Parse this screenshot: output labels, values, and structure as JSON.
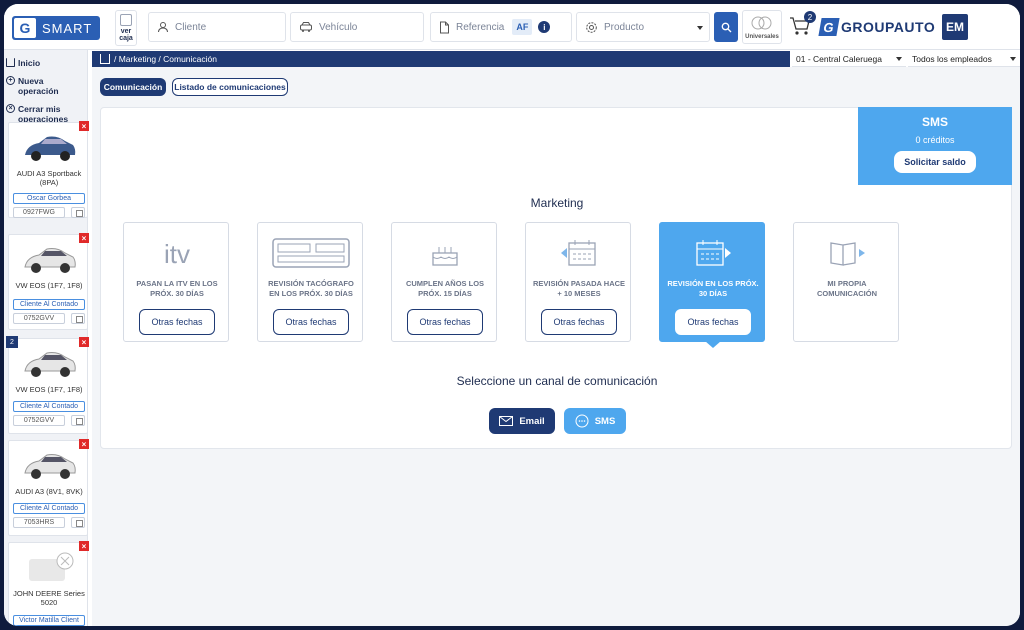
{
  "brand": {
    "app_name": "SMART",
    "groupauto": "GROUPAUTO",
    "avatar_initials": "EM"
  },
  "topbar": {
    "ver_caja": "ver caja",
    "cliente_placeholder": "Cliente",
    "vehiculo_placeholder": "Vehículo",
    "referencia_placeholder": "Referencia",
    "af_label": "AF",
    "info_label": "i",
    "producto_placeholder": "Producto",
    "universales_label": "Universales",
    "cart_count": "2"
  },
  "sidebar": {
    "items": [
      {
        "label": "Inicio",
        "icon": "home-icon"
      },
      {
        "label": "Nueva operación",
        "icon": "plus-circle-icon"
      },
      {
        "label": "Cerrar mis operaciones",
        "icon": "close-circle-icon"
      }
    ],
    "cards": [
      {
        "model": "AUDI A3 Sportback (8PA)",
        "client": "Oscar Gorbea",
        "plate": "0927FWG",
        "number": "",
        "car_color": "#3c5a8c"
      },
      {
        "model": "VW EOS (1F7, 1F8)",
        "client": "Cliente Al Contado",
        "plate": "0752GVV",
        "number": "",
        "car_color": "#e6e6e6"
      },
      {
        "model": "VW EOS (1F7, 1F8)",
        "client": "Cliente Al Contado",
        "plate": "0752GVV",
        "number": "2",
        "car_color": "#e6e6e6"
      },
      {
        "model": "AUDI A3 (8V1, 8VK)",
        "client": "Cliente Al Contado",
        "plate": "7053HRS",
        "number": "",
        "car_color": "#e6e6e6"
      },
      {
        "model": "JOHN DEERE Series 5020",
        "client": "Victor Matilla Client",
        "plate": "",
        "number": "",
        "car_color": "#dddddd"
      }
    ]
  },
  "breadcrumb": {
    "text": "/ Marketing / Comunicación"
  },
  "selectors": {
    "branch": "01 - Central Caleruega",
    "employees": "Todos los empleados"
  },
  "tabs": {
    "active": "Comunicación",
    "other": "Listado de comunicaciones"
  },
  "sms_box": {
    "title": "SMS",
    "credits": "0 créditos",
    "button": "Solicitar saldo"
  },
  "marketing": {
    "title": "Marketing",
    "options": [
      {
        "label": "PASAN LA ITV EN LOS PRÓX. 30 DÍAS",
        "button": "Otras fechas",
        "icon": "itv-icon",
        "active": false
      },
      {
        "label": "REVISIÓN TACÓGRAFO EN LOS PRÓX. 30 DÍAS",
        "button": "Otras fechas",
        "icon": "tachograph-icon",
        "active": false
      },
      {
        "label": "CUMPLEN AÑOS LOS PRÓX. 15 DÍAS",
        "button": "Otras fechas",
        "icon": "birthday-cake-icon",
        "active": false
      },
      {
        "label": "REVISIÓN PASADA HACE + 10 MESES",
        "button": "Otras fechas",
        "icon": "calendar-back-icon",
        "active": false
      },
      {
        "label": "REVISIÓN EN LOS PRÓX. 30 DÍAS",
        "button": "Otras fechas",
        "icon": "calendar-forward-icon",
        "active": true
      },
      {
        "label": "MI PROPIA COMUNICACIÓN",
        "button": "",
        "icon": "book-send-icon",
        "active": false
      }
    ]
  },
  "channels": {
    "title": "Seleccione un canal de comunicación",
    "email": "Email",
    "sms": "SMS"
  },
  "colors": {
    "navy": "#1f3a74",
    "accent_blue": "#4ea7ee",
    "brand_blue": "#2b5fb4",
    "close_red": "#e02929"
  }
}
